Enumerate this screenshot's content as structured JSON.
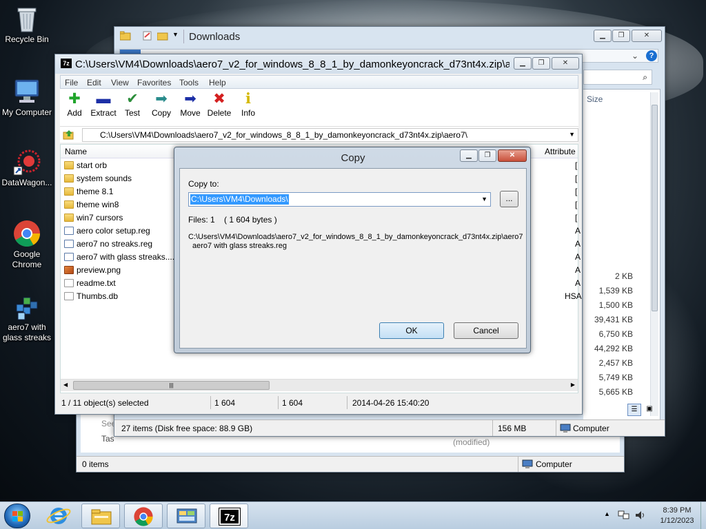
{
  "desktop": {
    "icons": [
      {
        "label": "Recycle Bin",
        "icon": "recycle-bin-icon"
      },
      {
        "label": "My Computer",
        "icon": "computer-icon"
      },
      {
        "label": "DataWagon...",
        "icon": "datawagon-icon"
      },
      {
        "label": "Google Chrome",
        "icon": "chrome-icon"
      },
      {
        "label": "aero7 with glass streaks",
        "icon": "registry-file-icon"
      }
    ]
  },
  "explorer": {
    "title": "Downloads",
    "size_header": "Size",
    "sizes": [
      "2 KB",
      "1,539 KB",
      "1,500 KB",
      "39,431 KB",
      "6,750 KB",
      "44,292 KB",
      "2,457 KB",
      "5,749 KB",
      "5,665 KB"
    ],
    "status_items": "27 items (Disk free space: 88.9 GB)",
    "status_size": "156 MB",
    "status_location": "Computer"
  },
  "back_window": {
    "status_items": "0 items",
    "status_location": "Computer",
    "modified": "(modified)",
    "see_label": "See",
    "task_label": "Tas"
  },
  "sevenzip": {
    "title": "C:\\Users\\VM4\\Downloads\\aero7_v2_for_windows_8_8_1_by_damonkeyoncrack_d73nt4x.zip\\ae...",
    "menu": [
      "File",
      "Edit",
      "View",
      "Favorites",
      "Tools",
      "Help"
    ],
    "toolbar": [
      {
        "label": "Add",
        "icon": "plus-icon",
        "color": "#21a52c"
      },
      {
        "label": "Extract",
        "icon": "minus-icon",
        "color": "#1c2fa6"
      },
      {
        "label": "Test",
        "icon": "check-icon",
        "color": "#2b8d3a"
      },
      {
        "label": "Copy",
        "icon": "copy-arrow-icon",
        "color": "#2a8c8c"
      },
      {
        "label": "Move",
        "icon": "move-arrow-icon",
        "color": "#1c2fa6"
      },
      {
        "label": "Delete",
        "icon": "delete-x-icon",
        "color": "#d42020"
      },
      {
        "label": "Info",
        "icon": "info-icon",
        "color": "#d4b800"
      }
    ],
    "address": "C:\\Users\\VM4\\Downloads\\aero7_v2_for_windows_8_8_1_by_damonkeyoncrack_d73nt4x.zip\\aero7\\",
    "columns": {
      "name": "Name",
      "attributes": "Attribute"
    },
    "files": [
      {
        "name": "start orb",
        "type": "folder",
        "attr": "["
      },
      {
        "name": "system sounds",
        "type": "folder",
        "attr": "["
      },
      {
        "name": "theme 8.1",
        "type": "folder",
        "attr": "["
      },
      {
        "name": "theme win8",
        "type": "folder",
        "attr": "["
      },
      {
        "name": "win7 cursors",
        "type": "folder",
        "attr": "["
      },
      {
        "name": "aero color setup.reg",
        "type": "reg",
        "attr": "A"
      },
      {
        "name": "aero7 no streaks.reg",
        "type": "reg",
        "attr": "A"
      },
      {
        "name": "aero7 with glass streaks....",
        "type": "reg",
        "attr": "A"
      },
      {
        "name": "preview.png",
        "type": "png",
        "attr": "A"
      },
      {
        "name": "readme.txt",
        "type": "txt",
        "attr": "A"
      },
      {
        "name": "Thumbs.db",
        "type": "txt",
        "attr": "HSA"
      }
    ],
    "status": {
      "selected": "1 / 11 object(s) selected",
      "size": "1 604",
      "packed": "1 604",
      "modified": "2014-04-26 15:40:20"
    }
  },
  "copy_dialog": {
    "title": "Copy",
    "copy_to_label": "Copy to:",
    "path_value": "C:\\Users\\VM4\\Downloads\\",
    "browse_label": "...",
    "files_info": "Files: 1    ( 1 604 bytes )",
    "source_line1": "C:\\Users\\VM4\\Downloads\\aero7_v2_for_windows_8_8_1_by_damonkeyoncrack_d73nt4x.zip\\aero7",
    "source_line2": "aero7 with glass streaks.reg",
    "ok_label": "OK",
    "cancel_label": "Cancel"
  },
  "taskbar": {
    "time": "8:39 PM",
    "date": "1/12/2023",
    "pinned": [
      "start-orb-icon",
      "internet-explorer-icon",
      "file-explorer-icon",
      "chrome-icon",
      "control-panel-icon",
      "7zip-icon"
    ],
    "sevenzip_label": "7z"
  }
}
